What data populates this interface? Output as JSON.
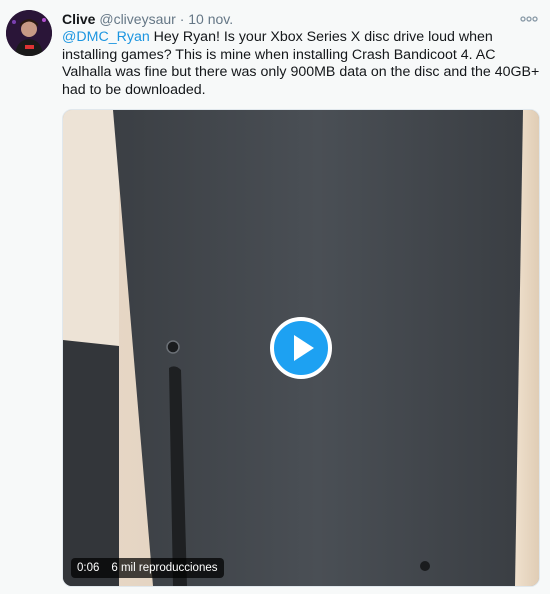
{
  "tweet": {
    "author": {
      "name": "Clive",
      "handle": "@cliveysaur"
    },
    "separator": "·",
    "date": "10 nov.",
    "mention": "@DMC_Ryan",
    "text": " Hey Ryan! Is your Xbox Series X disc drive loud when installing games? This is mine when installing Crash Bandicoot 4. AC Valhalla was fine but there was only 900MB data on the disc and the 40GB+ had to be downloaded.",
    "more_icon": "more-horizontal-icon"
  },
  "video": {
    "elapsed": "0:06",
    "views": "6 mil reproducciones",
    "play_icon": "play-icon",
    "accent_color": "#1da1f2"
  }
}
